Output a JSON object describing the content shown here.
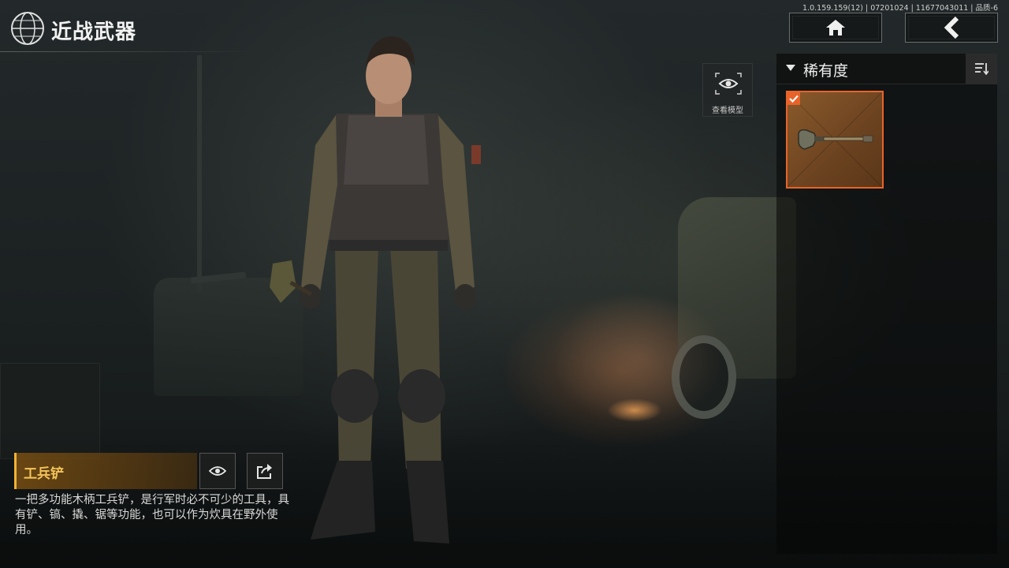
{
  "header": {
    "title": "近战武器",
    "version": "1.0.159.159(12) | 07201024 | 11677043011 | 品质-6",
    "home_icon": "home-icon",
    "back_icon": "chevron-left-icon"
  },
  "viewer": {
    "view_model_label": "查看模型",
    "icon": "eye-icon"
  },
  "filter_panel": {
    "filter_label": "稀有度",
    "sort_icon": "sort-icon",
    "items": [
      {
        "name_icon": "shovel-icon",
        "selected": true,
        "rarity_color": "#e8632a"
      }
    ]
  },
  "weapon": {
    "name": "工兵铲",
    "description": "一把多功能木柄工兵铲，是行军时必不可少的工具，具有铲、镐、撬、锯等功能，也可以作为炊具在野外使用。"
  },
  "colors": {
    "accent_gold": "#f2b233",
    "rarity_orange": "#e8632a",
    "panel_dark": "#0a0a0a"
  }
}
